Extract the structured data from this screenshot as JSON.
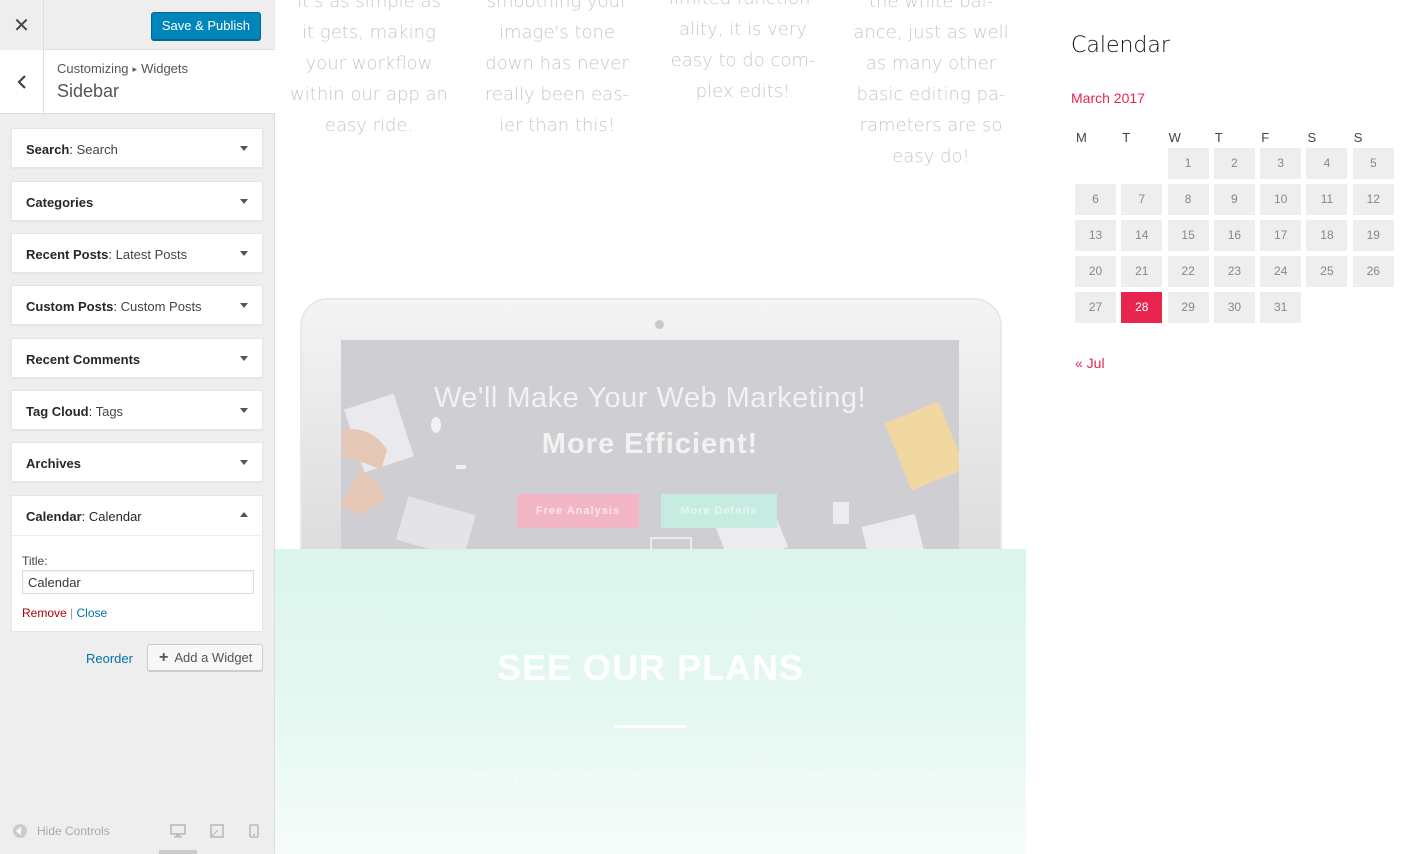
{
  "header": {
    "save_label": "Save & Publish"
  },
  "section": {
    "breadcrumb_root": "Customizing",
    "breadcrumb_sep": "▸",
    "breadcrumb_parent": "Widgets",
    "title": "Sidebar"
  },
  "widgets": [
    {
      "type": "Search",
      "instance": "Search"
    },
    {
      "type": "Categories",
      "instance": ""
    },
    {
      "type": "Recent Posts",
      "instance": "Latest Posts"
    },
    {
      "type": "Custom Posts",
      "instance": "Custom Posts"
    },
    {
      "type": "Recent Comments",
      "instance": ""
    },
    {
      "type": "Tag Cloud",
      "instance": "Tags"
    },
    {
      "type": "Archives",
      "instance": ""
    }
  ],
  "calendar_widget": {
    "type": "Calendar",
    "instance": "Calendar",
    "title_label": "Title:",
    "title_value": "Calendar",
    "remove_label": "Remove",
    "separator": "|",
    "close_label": "Close"
  },
  "actions": {
    "reorder_label": "Reorder",
    "add_widget_label": "Add a Widget"
  },
  "footer": {
    "hide_controls_label": "Hide Controls",
    "devices": [
      "desktop-icon",
      "tablet-icon",
      "mobile-icon"
    ]
  },
  "preview": {
    "features": [
      [
        "it's as simple as",
        "it gets, making",
        "your workflow",
        "within our app an",
        "easy ride."
      ],
      [
        "smoothing your",
        "image's tone",
        "down has never",
        "really been eas-",
        "ier than this!"
      ],
      [
        "limited function-",
        "ality, it is very",
        "easy to do com-",
        "plex edits!"
      ],
      [
        "the white bal-",
        "ance, just as well",
        "as many other",
        "basic editing pa-",
        "rameters are so",
        "easy do!"
      ]
    ],
    "hero_line1": "We'll Make Your Web Marketing!",
    "hero_line2": "More Efficient!",
    "hero_button1": "Free Analysis",
    "hero_button2": "More Details",
    "plans_title": "SEE OUR PLANS",
    "plans_text": "Our app is one of the most functional photo post-processing offers on the market!"
  },
  "calendar": {
    "heading": "Calendar",
    "caption": "March 2017",
    "weekdays": [
      "M",
      "T",
      "W",
      "T",
      "F",
      "S",
      "S"
    ],
    "weeks": [
      [
        "",
        "",
        "1",
        "2",
        "3",
        "4",
        "5"
      ],
      [
        "6",
        "7",
        "8",
        "9",
        "10",
        "11",
        "12"
      ],
      [
        "13",
        "14",
        "15",
        "16",
        "17",
        "18",
        "19"
      ],
      [
        "20",
        "21",
        "22",
        "23",
        "24",
        "25",
        "26"
      ],
      [
        "27",
        "28",
        "29",
        "30",
        "31",
        "",
        ""
      ]
    ],
    "today": "28",
    "prev_link": "« Jul",
    "accent_color": "#e8254f"
  },
  "colors": {
    "primary_button": "#0085ba",
    "link": "#0073aa",
    "remove": "#aa0000"
  }
}
